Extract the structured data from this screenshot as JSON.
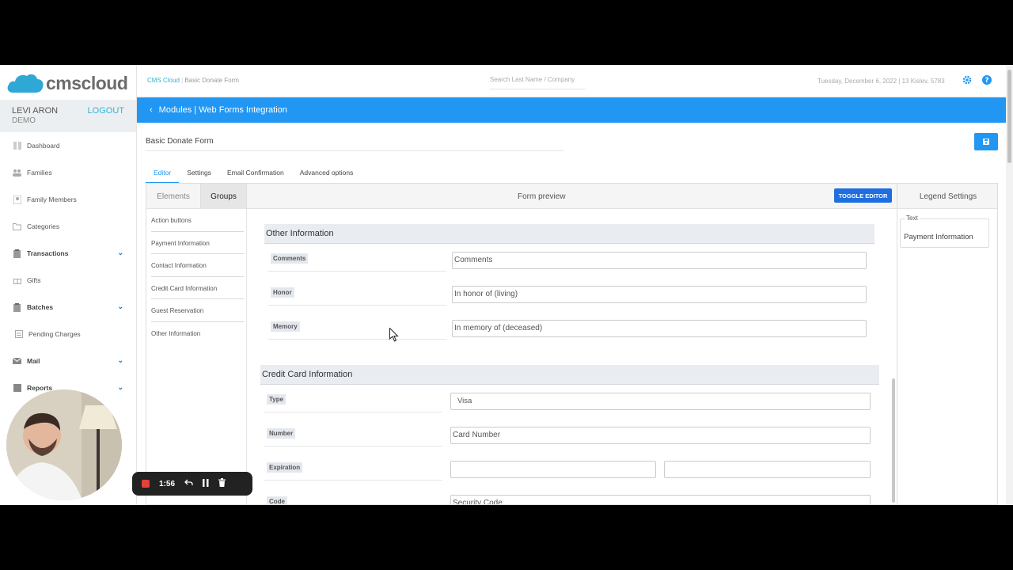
{
  "app": {
    "brand": "cmscloud",
    "colors": {
      "accent": "#2196f3",
      "link": "#2fb4d0",
      "toggle": "#1e6ee0"
    }
  },
  "user": {
    "name": "LEVI ARON",
    "role": "DEMO",
    "logout": "LOGOUT"
  },
  "sidebar": {
    "items": [
      {
        "label": "Dashboard",
        "icon": "dashboard-icon"
      },
      {
        "label": "Families",
        "icon": "families-icon"
      },
      {
        "label": "Family Members",
        "icon": "family-members-icon"
      },
      {
        "label": "Categories",
        "icon": "folder-icon"
      },
      {
        "label": "Transactions",
        "icon": "clipboard-icon",
        "expandable": true
      },
      {
        "label": "Gifts",
        "icon": "gift-icon"
      },
      {
        "label": "Batches",
        "icon": "batch-icon",
        "expandable": true
      },
      {
        "label": "Pending Charges",
        "icon": "pending-icon"
      },
      {
        "label": "Mail",
        "icon": "mail-icon",
        "expandable": true
      },
      {
        "label": "Reports",
        "icon": "reports-icon",
        "expandable": true
      }
    ]
  },
  "header": {
    "breadcrumb_root": "CMS Cloud",
    "breadcrumb_current": "Basic Donate Form",
    "search_placeholder": "Search Last Name / Company",
    "date": "Tuesday, December 6, 2022 | 13 Kislev, 5783"
  },
  "banner": {
    "title": "Modules | Web Forms Integration"
  },
  "form": {
    "name": "Basic Donate Form"
  },
  "tabs": [
    "Editor",
    "Settings",
    "Email Confirmation",
    "Advanced options"
  ],
  "editor": {
    "elements_tab": "Elements",
    "groups_tab": "Groups",
    "preview_title": "Form preview",
    "toggle_label": "TOGGLE EDITOR",
    "legend_title": "Legend Settings",
    "groups": [
      "Action buttons",
      "Payment Information",
      "Contact Information",
      "Credit Card Information",
      "Guest Reservation",
      "Other Information"
    ],
    "other_section": {
      "title": "Other Information",
      "rows": [
        {
          "label": "Comments",
          "value": "Comments"
        },
        {
          "label": "Honor",
          "value": "In honor of (living)"
        },
        {
          "label": "Memory",
          "value": "In memory of (deceased)"
        }
      ]
    },
    "card_section": {
      "title": "Credit Card Information",
      "type_label": "Type",
      "type_value": "Visa",
      "number_label": "Number",
      "number_value": "Card Number",
      "expiration_label": "Expiration",
      "code_label": "Code",
      "code_value": "Security Code"
    },
    "legend": {
      "field_label": "Text",
      "field_value": "Payment Information"
    }
  },
  "recording": {
    "time": "1:56"
  }
}
